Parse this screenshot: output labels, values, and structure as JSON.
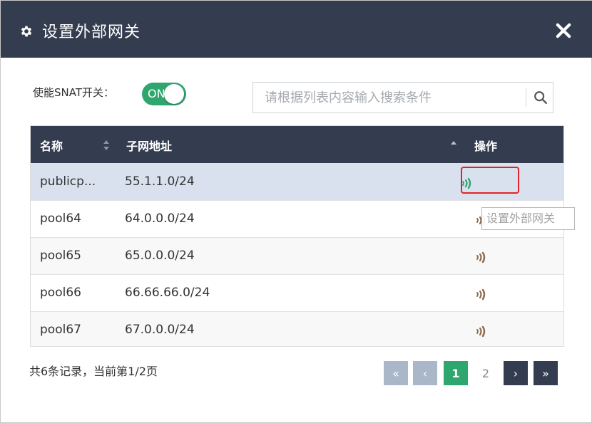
{
  "dialog": {
    "title": "设置外部网关",
    "title_icon": "gear-icon",
    "close_icon": "close-icon"
  },
  "snat": {
    "label": "使能SNAT开关：",
    "toggle_text": "ON",
    "enabled": true
  },
  "search": {
    "placeholder": "请根据列表内容输入搜索条件",
    "value": "",
    "icon": "search-icon"
  },
  "table": {
    "columns": [
      "名称",
      "子网地址",
      "操作"
    ],
    "rows": [
      {
        "name": "publicp...",
        "subnet": "55.1.1.0/24",
        "selected": true
      },
      {
        "name": "pool64",
        "subnet": "64.0.0.0/24",
        "selected": false
      },
      {
        "name": "pool65",
        "subnet": "65.0.0.0/24",
        "selected": false
      },
      {
        "name": "pool66",
        "subnet": "66.66.66.0/24",
        "selected": false
      },
      {
        "name": "pool67",
        "subnet": "67.0.0.0/24",
        "selected": false
      }
    ],
    "action_icon": "set-gateway-icon"
  },
  "tooltip": {
    "text": "设置外部网关"
  },
  "footer": {
    "record_info": "共6条记录，当前第1/2页"
  },
  "pagination": {
    "first": "«",
    "prev": "‹",
    "page1": "1",
    "page2": "2",
    "next": "›",
    "last": "»",
    "current_page": 1,
    "total_pages": 2
  },
  "colors": {
    "header_bg": "#343d4f",
    "accent_green": "#2fa66d",
    "selected_row": "#d9e1ee",
    "highlight_red": "#e0222a"
  }
}
